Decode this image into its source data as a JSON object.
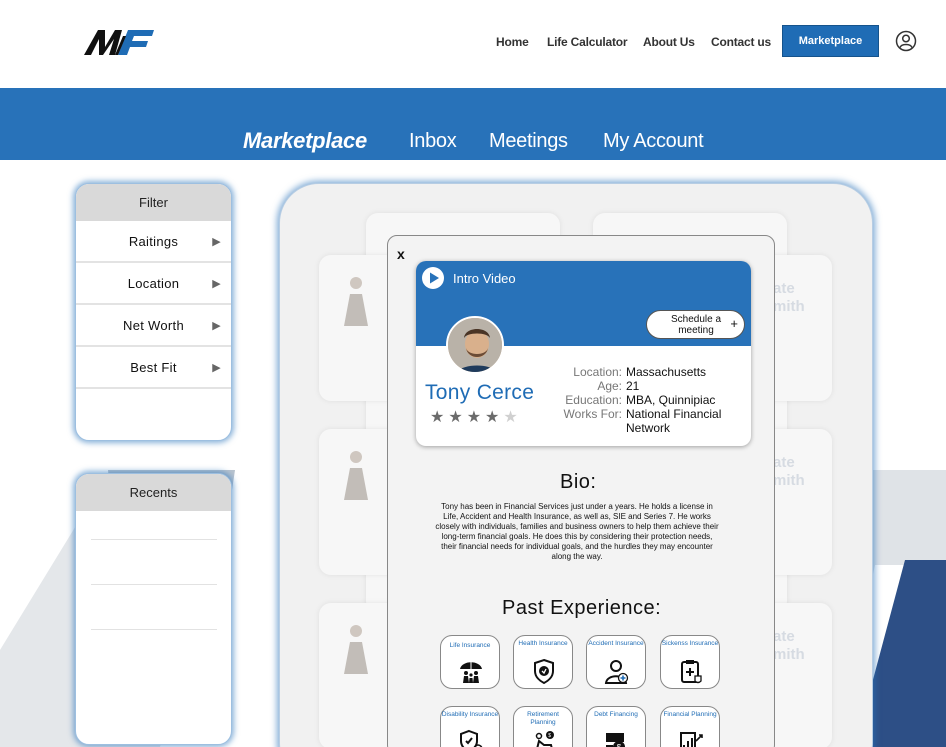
{
  "header": {
    "logo_text": "MF",
    "nav": [
      "Home",
      "Life Calculator",
      "About Us",
      "Contact us"
    ],
    "cta": "Marketplace",
    "user_icon": "user-circle-icon"
  },
  "tabs": [
    "Marketplace",
    "Inbox",
    "Meetings",
    "My Account"
  ],
  "filter": {
    "title": "Filter",
    "items": [
      "Raitings",
      "Location",
      "Net Worth",
      "Best Fit"
    ],
    "arrow_glyph": "▶"
  },
  "recents": {
    "title": "Recents"
  },
  "background_cards": {
    "partial_text_line1": "ate",
    "partial_text_line2": "mith"
  },
  "modal": {
    "close": "x",
    "intro_video": "Intro Video",
    "schedule": "Schedule a meeting",
    "schedule_plus": "+",
    "name": "Tony Cerce",
    "rating": 4,
    "rating_max": 5,
    "star_glyph": "★",
    "details": [
      {
        "label": "Location:",
        "value": "Massachusetts"
      },
      {
        "label": "Age:",
        "value": "21"
      },
      {
        "label": "Education:",
        "value": "MBA, Quinnipiac"
      },
      {
        "label": "Works For:",
        "value": "National Financial Network"
      }
    ],
    "bio_title": "Bio:",
    "bio": "Tony has been in Financial Services just under a years. He holds a license in Life, Accident and Health Insurance, as well as, SIE and Series 7. He works closely with individuals, families and business owners to help them achieve their long-term financial goals. He does this by considering their protection needs, their financial needs for individual goals, and the hurdles they may encounter along the way.",
    "experience_title": "Past Experience:",
    "experience": [
      {
        "label": "Life Insurance",
        "icon": "family-umbrella-icon"
      },
      {
        "label": "Health Insurance",
        "icon": "health-shield-icon"
      },
      {
        "label": "Accident Insurance",
        "icon": "doctor-icon"
      },
      {
        "label": "Sickenss Insurance",
        "icon": "clipboard-medical-icon"
      },
      {
        "label": "Disability Insurance",
        "icon": "disability-shield-icon"
      },
      {
        "label": "Retirement Planning",
        "icon": "retirement-chair-icon"
      },
      {
        "label": "Debt Financing",
        "icon": "money-hand-icon"
      },
      {
        "label": "Financial Planning",
        "icon": "planning-chart-icon"
      }
    ]
  },
  "colors": {
    "brand_blue": "#2872b9",
    "button_blue": "#1f6cb5",
    "panel_gray": "#d9d9d9"
  }
}
